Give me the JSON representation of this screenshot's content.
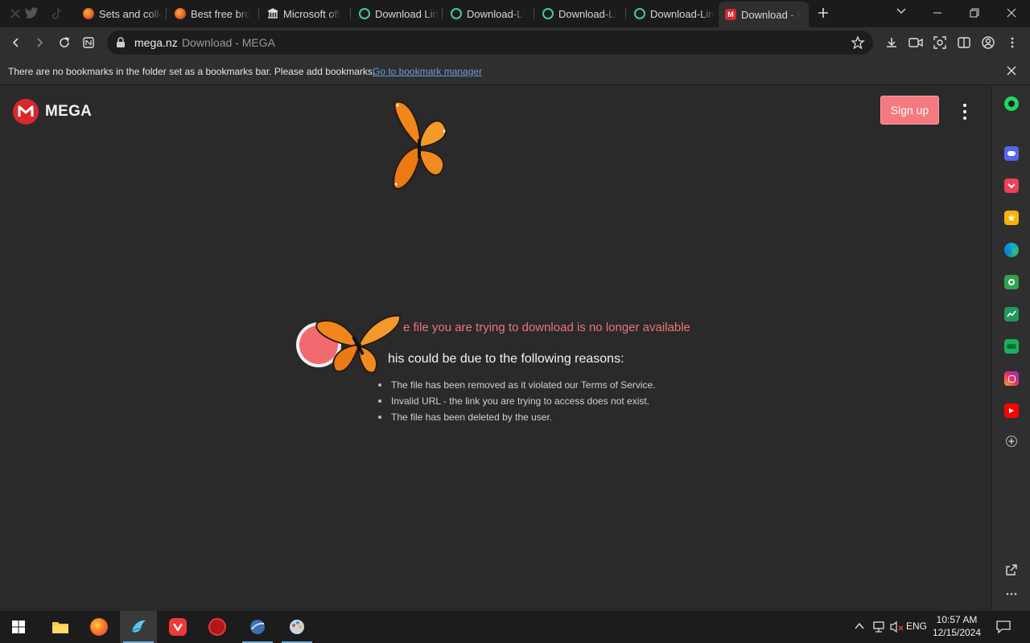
{
  "tabs": [
    {
      "title": "Sets and colle",
      "icon": "firefox-icon"
    },
    {
      "title": "Best free bro",
      "icon": "firefox-icon"
    },
    {
      "title": "Microsoft off",
      "icon": "building-icon"
    },
    {
      "title": "Download Lin",
      "icon": "circle-icon"
    },
    {
      "title": "Download-Li",
      "icon": "circle-icon"
    },
    {
      "title": "Download-Li",
      "icon": "circle-icon"
    },
    {
      "title": "Download-Lin",
      "icon": "circle-icon"
    },
    {
      "title": "Download - I",
      "icon": "mega-icon"
    }
  ],
  "address": {
    "host": "mega.nz",
    "title": "Download - MEGA"
  },
  "bookmarks_bar": {
    "message": "There are no bookmarks in the folder set as a bookmarks bar. Please add bookmarks.",
    "link": "Go to bookmark manager"
  },
  "page": {
    "logo_text": "MEGA",
    "signup_label": "Sign up",
    "error_title": "e file you are trying to download is no longer available",
    "reasons_heading": "his could be due to the following reasons:",
    "reasons": [
      "The file has been removed as it violated our Terms of Service.",
      "Invalid URL - the link you are trying to access does not exist.",
      "The file has been deleted by the user."
    ]
  },
  "taskbar": {
    "language": "ENG",
    "time": "10:57 AM",
    "date": "12/15/2024"
  },
  "colors": {
    "accent_red": "#d9272e",
    "signup_bg": "#f47a7f",
    "error_text": "#f07278"
  }
}
